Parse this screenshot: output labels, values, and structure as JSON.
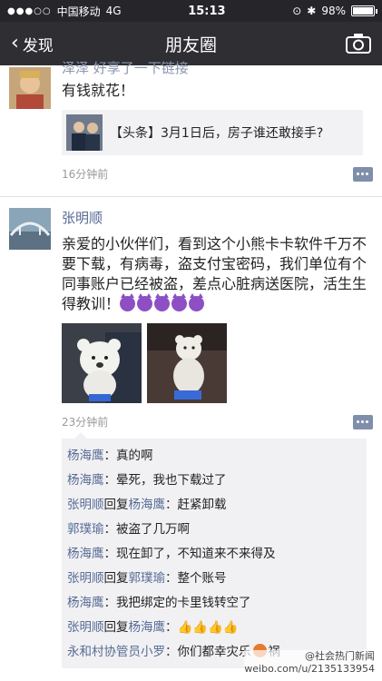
{
  "status_bar": {
    "signal": "●●●○○",
    "carrier": "中国移动",
    "network": "4G",
    "time": "15:13",
    "battery_text": "98%",
    "battery_level": 0.98
  },
  "nav": {
    "back_label": "发现",
    "title": "朋友圈"
  },
  "posts": [
    {
      "username": "泽泽 好享了一下链接",
      "text": "有钱就花！",
      "share_title": "【头条】3月1日后，房子谁还敢接手?",
      "time": "16分钟前"
    },
    {
      "username": "张明顺",
      "text": "亲爱的小伙伴们，看到这个小熊卡卡软件千万不要下载，有病毒，盗支付宝密码，我们单位有个同事账户已经被盗，差点心脏病送医院，活生生得教训！",
      "time": "23分钟前"
    }
  ],
  "comments": [
    {
      "name": "杨海鹰",
      "text": "真的啊"
    },
    {
      "name": "杨海鹰",
      "text": "晕死，我也下载过了"
    },
    {
      "name": "张明顺",
      "reply_word": "回复",
      "reply_to": "杨海鹰",
      "text": "赶紧卸载"
    },
    {
      "name": "郭璞瑜",
      "text": "被盗了几万啊"
    },
    {
      "name": "杨海鹰",
      "text": "现在卸了，不知道来不来得及"
    },
    {
      "name": "张明顺",
      "reply_word": "回复",
      "reply_to": "郭璞瑜",
      "text": "整个账号"
    },
    {
      "name": "杨海鹰",
      "text": "我把绑定的卡里钱转空了"
    },
    {
      "name": "张明顺",
      "reply_word": "回复",
      "reply_to": "杨海鹰",
      "text": "👍👍👍👍"
    },
    {
      "name": "永和村协管员小罗",
      "text": "你们都幸灾乐",
      "text_end": "祸"
    }
  ],
  "watermark": {
    "handle": "@社会热门新闻",
    "url": "weibo.com/u/2135133954"
  },
  "colors": {
    "nav_bg": "#2e2e33",
    "name_blue": "#576b95",
    "comment_bg": "#f1f1f3"
  }
}
